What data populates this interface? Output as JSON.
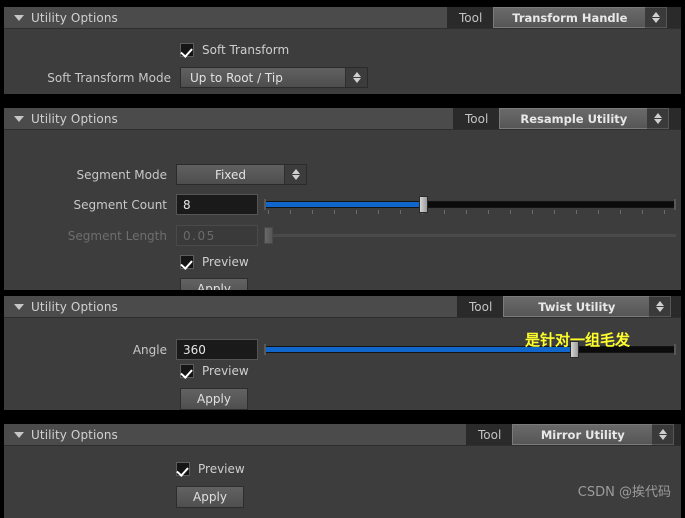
{
  "common": {
    "panel_title": "Utility Options",
    "tool_label": "Tool",
    "preview_label": "Preview",
    "apply_label": "Apply",
    "collapse_icon": "triangle-down-icon",
    "spinner_icon": "spinner-updown-icon",
    "accent_color": "#1166cc",
    "panel_bg": "#3d3d3d",
    "header_bg": "#4b4b4b"
  },
  "panels": [
    {
      "title": "Utility Options",
      "tool_label": "Tool",
      "tool_value": "Transform Handle",
      "checkbox": {
        "label": "Soft Transform",
        "checked": true
      },
      "mode": {
        "label": "Soft Transform Mode",
        "value": "Up to Root / Tip"
      }
    },
    {
      "title": "Utility Options",
      "tool_label": "Tool",
      "tool_value": "Resample Utility",
      "segment_mode": {
        "label": "Segment Mode",
        "value": "Fixed"
      },
      "segment_count": {
        "label": "Segment Count",
        "value": "8",
        "slider_percent": 39,
        "tick_count": 19
      },
      "segment_length": {
        "label": "Segment Length",
        "value": "0.05",
        "enabled": false,
        "slider_percent": 1
      },
      "checkbox": {
        "label": "Preview",
        "checked": true
      },
      "apply_label": "Apply"
    },
    {
      "title": "Utility Options",
      "tool_label": "Tool",
      "tool_value": "Twist Utility",
      "angle": {
        "label": "Angle",
        "value": "360",
        "slider_percent": 76
      },
      "checkbox": {
        "label": "Preview",
        "checked": true
      },
      "apply_label": "Apply",
      "annotation": "是针对一组毛发"
    },
    {
      "title": "Utility Options",
      "tool_label": "Tool",
      "tool_value": "Mirror Utility",
      "checkbox": {
        "label": "Preview",
        "checked": true
      },
      "apply_label": "Apply"
    }
  ],
  "watermark": "CSDN @挨代码"
}
